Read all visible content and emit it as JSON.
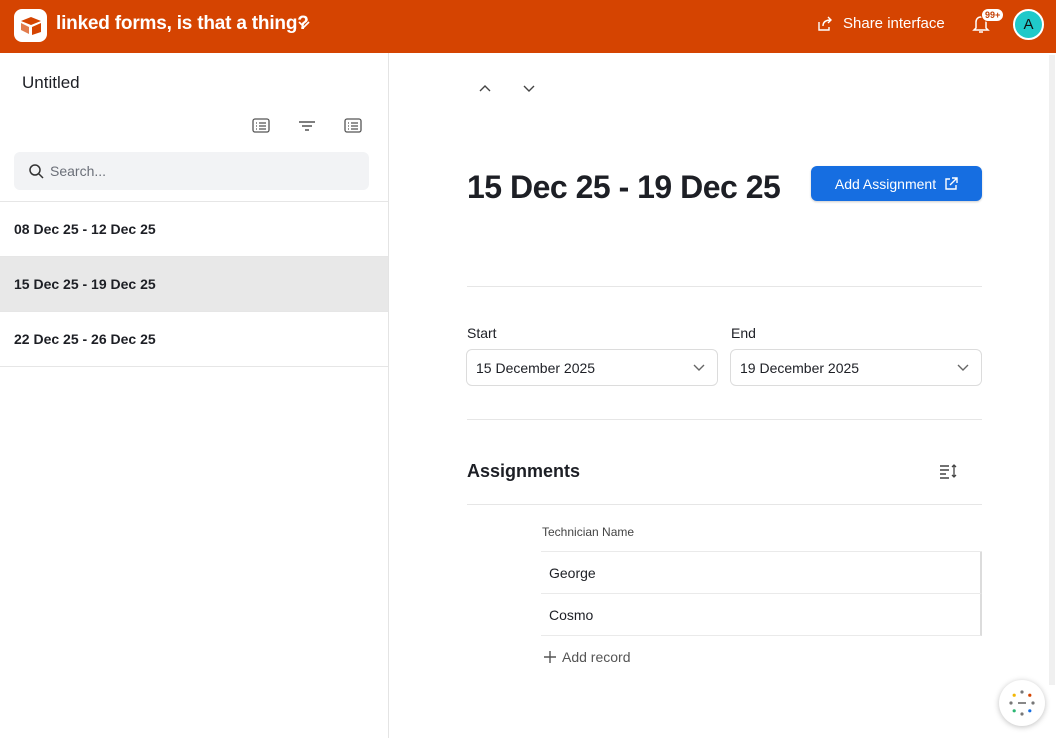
{
  "header": {
    "title": "linked forms, is that a thing?",
    "share_label": "Share interface",
    "notification_count": "99+",
    "avatar_initial": "A",
    "brand_color": "#d54401"
  },
  "sidebar": {
    "title": "Untitled",
    "search_placeholder": "Search...",
    "items": [
      {
        "label": "08 Dec 25 - 12 Dec 25",
        "active": false
      },
      {
        "label": "15 Dec 25 - 19 Dec 25",
        "active": true
      },
      {
        "label": "22 Dec 25 - 26 Dec 25",
        "active": false
      }
    ]
  },
  "main": {
    "title": "15 Dec 25 - 19 Dec 25",
    "add_button_label": "Add Assignment",
    "start_label": "Start",
    "start_value": "15 December 2025",
    "end_label": "End",
    "end_value": "19 December 2025",
    "assignments_title": "Assignments",
    "table": {
      "column": "Technician Name",
      "rows": [
        "George",
        "Cosmo"
      ],
      "add_record_label": "Add record"
    },
    "accent_color": "#166ee1"
  }
}
